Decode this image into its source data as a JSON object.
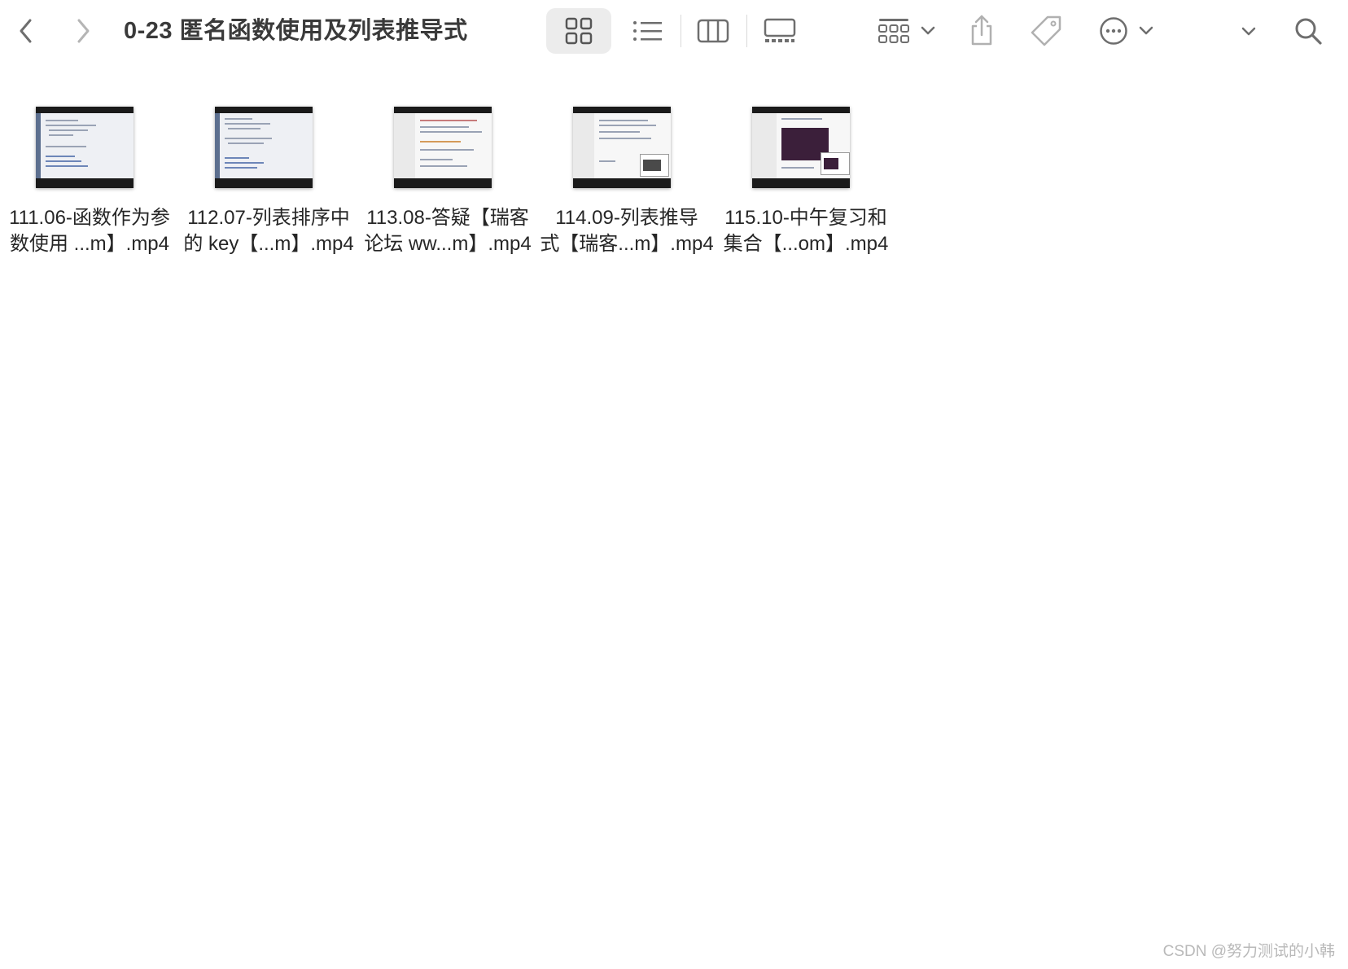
{
  "window": {
    "title": "0-23 匿名函数使用及列表推导式"
  },
  "toolbar": {
    "back_icon": "chevron-left-icon",
    "forward_icon": "chevron-right-icon",
    "views": [
      "icon-view-icon",
      "list-view-icon",
      "column-view-icon",
      "gallery-view-icon"
    ],
    "active_view": "icon-view",
    "group_icon": "group-grid-icon",
    "share_icon": "share-icon",
    "tag_icon": "tag-icon",
    "more_icon": "ellipsis-circle-icon",
    "search_icon": "search-icon"
  },
  "files": [
    {
      "line1": "111.06-函数作为参",
      "line2": "数使用 ...m】.mp4",
      "thumb": "light-code"
    },
    {
      "line1": "112.07-列表排序中",
      "line2": "的 key【...m】.mp4",
      "thumb": "light-code"
    },
    {
      "line1": "113.08-答疑【瑞客",
      "line2": "论坛 ww...m】.mp4",
      "thumb": "doc"
    },
    {
      "line1": "114.09-列表推导",
      "line2": "式【瑞客...m】.mp4",
      "thumb": "doc-popup"
    },
    {
      "line1": "115.10-中午复习和",
      "line2": "集合【...om】.mp4",
      "thumb": "terminal"
    }
  ],
  "watermark": "CSDN @努力测试的小韩",
  "colors": {
    "active_view_bg": "#ececec",
    "icon": "#6e6e6e",
    "terminal": "#3b1f3a"
  }
}
